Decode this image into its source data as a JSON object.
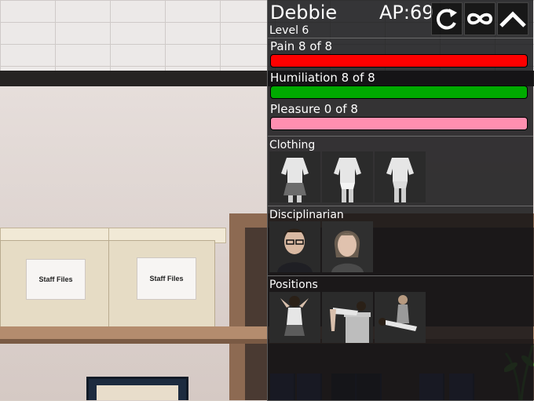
{
  "character": {
    "name": "Debbie",
    "ap_text": "AP:69",
    "level_text": "Level 6"
  },
  "controls": {
    "refresh_icon": "refresh-icon",
    "infinity_icon": "infinity-icon",
    "collapse_icon": "chevron-up-icon"
  },
  "stats": [
    {
      "label": "Pain 8 of 8",
      "value": 8,
      "max": 8,
      "color": "#ff0000"
    },
    {
      "label": "Humiliation 8 of 8",
      "value": 8,
      "max": 8,
      "color": "#00aa00"
    },
    {
      "label": "Pleasure 0 of 8",
      "value": 0,
      "max": 8,
      "color": "#ff8fb0",
      "track_color": "#ff8fb0"
    }
  ],
  "sections": {
    "clothing": {
      "title": "Clothing"
    },
    "disciplinarian": {
      "title": "Disciplinarian"
    },
    "positions": {
      "title": "Positions"
    }
  },
  "scene": {
    "box_label_1": "Staff Files",
    "box_label_2": "Staff Files"
  }
}
